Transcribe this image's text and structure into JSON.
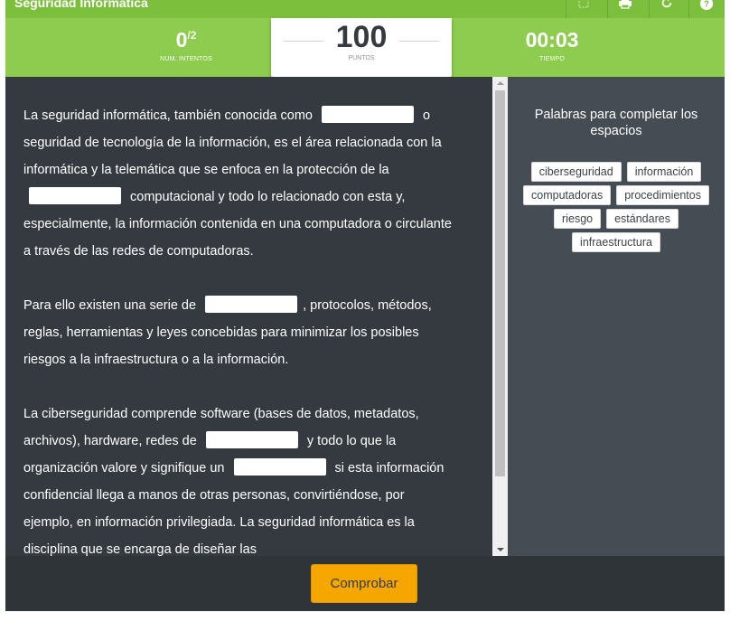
{
  "app": {
    "title": "Seguridad Informática",
    "toolbar_icons": [
      "fullscreen-icon",
      "print-icon",
      "refresh-icon",
      "help-icon"
    ]
  },
  "stats": {
    "attempts_value": "0",
    "attempts_total": "/2",
    "attempts_label": "NUM. INTENTOS",
    "score_value": "100",
    "score_label": "PUNTOS",
    "time_value": "00:03",
    "time_label": "TIEMPO"
  },
  "text": {
    "p1": {
      "s1": "La seguridad informática, también conocida como",
      "s2": "o seguridad de tecnología de la información, es el área relacionada con la informática y la telemática que se enfoca en la protección de la",
      "s3": "computacional y todo lo relacionado con esta y, especialmente, la información contenida en una computadora o circulante a través de las redes de computadoras."
    },
    "p2": {
      "s1": "Para ello existen una serie de",
      "s2": ", protocolos, métodos, reglas, herramientas y leyes concebidas para minimizar los posibles riesgos a la infraestructura o a la información."
    },
    "p3": {
      "s1": "La ciberseguridad comprende software (bases de datos, metadatos, archivos), hardware, redes de",
      "s2": "y todo lo que la organización valore y signifique un",
      "s3": "si esta información confidencial llega a manos de otras personas, convirtiéndose, por ejemplo, en información privilegiada. La seguridad informática es la disciplina que se encarga de diseñar las"
    }
  },
  "wordbank": {
    "title": "Palabras para completar los espacios",
    "words": [
      "ciberseguridad",
      "información",
      "computadoras",
      "procedimientos",
      "riesgo",
      "estándares",
      "infraestructura"
    ]
  },
  "footer": {
    "check_label": "Comprobar"
  },
  "colors": {
    "title_bar": "#7bbf3c",
    "stats_bar": "#8dcc4f",
    "panel_dark": "#343a40",
    "wordbank_bg": "#454c53",
    "button": "#f5a700"
  }
}
